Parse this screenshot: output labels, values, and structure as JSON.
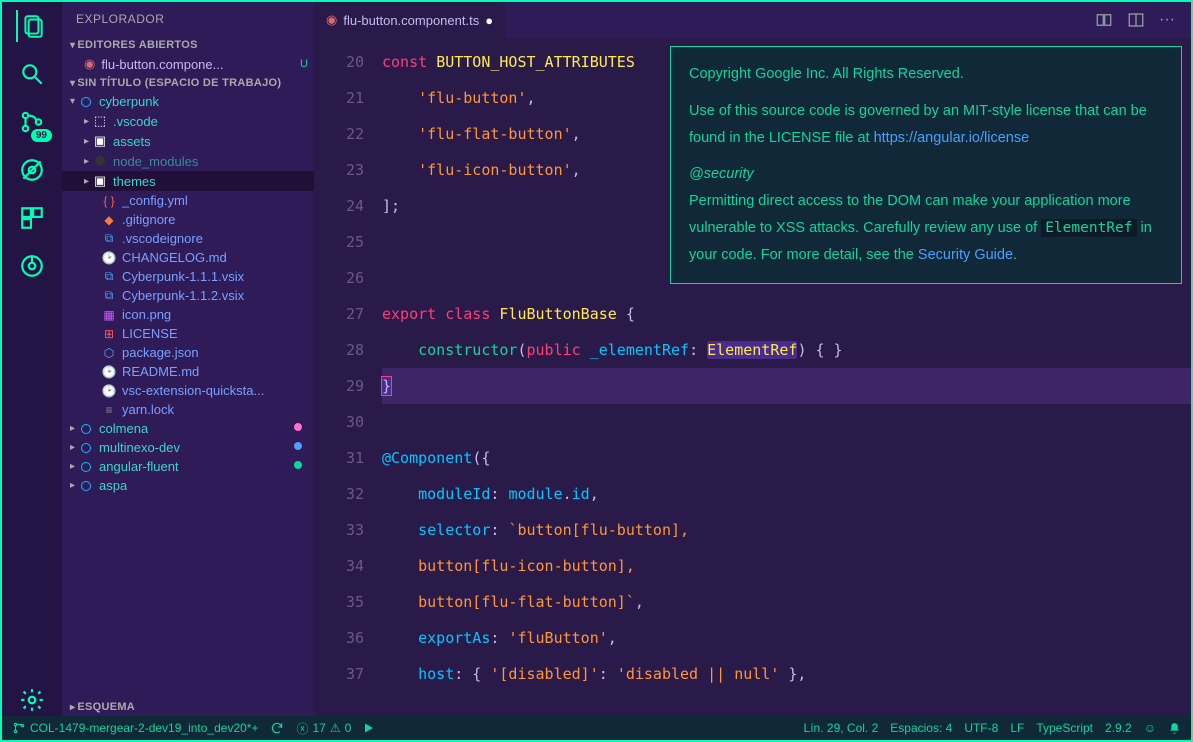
{
  "sidebar": {
    "title": "EXPLORADOR",
    "sections": {
      "open_editors": "EDITORES ABIERTOS",
      "workspace": "SIN TÍTULO (ESPACIO DE TRABAJO)",
      "outline": "ESQUEMA"
    },
    "open_editor": {
      "name": "flu-button.compone...",
      "status": "U"
    },
    "tree": [
      {
        "label": "cyberpunk",
        "kind": "root",
        "indent": 0
      },
      {
        "label": ".vscode",
        "kind": "folder",
        "indent": 1,
        "icon": "vscode"
      },
      {
        "label": "assets",
        "kind": "folder",
        "indent": 1,
        "icon": "assets"
      },
      {
        "label": "node_modules",
        "kind": "folder",
        "indent": 1,
        "icon": "node",
        "muted": true
      },
      {
        "label": "themes",
        "kind": "folder",
        "indent": 1,
        "icon": "folder",
        "selected": true
      },
      {
        "label": "_config.yml",
        "kind": "file",
        "indent": 2,
        "icon": "yml"
      },
      {
        "label": ".gitignore",
        "kind": "file",
        "indent": 2,
        "icon": "git"
      },
      {
        "label": ".vscodeignore",
        "kind": "file",
        "indent": 2,
        "icon": "vs"
      },
      {
        "label": "CHANGELOG.md",
        "kind": "file",
        "indent": 2,
        "icon": "md"
      },
      {
        "label": "Cyberpunk-1.1.1.vsix",
        "kind": "file",
        "indent": 2,
        "icon": "vs"
      },
      {
        "label": "Cyberpunk-1.1.2.vsix",
        "kind": "file",
        "indent": 2,
        "icon": "vs"
      },
      {
        "label": "icon.png",
        "kind": "file",
        "indent": 2,
        "icon": "img"
      },
      {
        "label": "LICENSE",
        "kind": "file",
        "indent": 2,
        "icon": "lic"
      },
      {
        "label": "package.json",
        "kind": "file",
        "indent": 2,
        "icon": "json"
      },
      {
        "label": "README.md",
        "kind": "file",
        "indent": 2,
        "icon": "md"
      },
      {
        "label": "vsc-extension-quicksta...",
        "kind": "file",
        "indent": 2,
        "icon": "md"
      },
      {
        "label": "yarn.lock",
        "kind": "file",
        "indent": 2,
        "icon": "lock"
      },
      {
        "label": "colmena",
        "kind": "root2",
        "indent": 0,
        "dot": "#ff70cc"
      },
      {
        "label": "multinexo-dev",
        "kind": "root2",
        "indent": 0,
        "dot": "#4da0ff"
      },
      {
        "label": "angular-fluent",
        "kind": "root2",
        "indent": 0,
        "dot": "#0dd69e"
      },
      {
        "label": "aspa",
        "kind": "root2",
        "indent": 0
      }
    ]
  },
  "activity": {
    "scm_badge": "99"
  },
  "tabs": {
    "current": "flu-button.component.ts"
  },
  "editor": {
    "lines": [
      {
        "n": 20,
        "html": "<span class='kw'>const</span> <span class='type'>BUTTON_HOST_ATTRIBUTES</span>"
      },
      {
        "n": 21,
        "html": "    <span class='str'>'flu-button'</span><span class='punc'>,</span>"
      },
      {
        "n": 22,
        "html": "    <span class='str'>'flu-flat-button'</span><span class='punc'>,</span>"
      },
      {
        "n": 23,
        "html": "    <span class='str'>'flu-icon-button'</span><span class='punc'>,</span>"
      },
      {
        "n": 24,
        "html": "<span class='punc'>];</span>"
      },
      {
        "n": 25,
        "html": ""
      },
      {
        "n": 26,
        "html": ""
      },
      {
        "n": 27,
        "html": "<span class='kw'>export</span> <span class='kw'>class</span> <span class='type'>FluButtonBase</span> <span class='punc'>{</span>"
      },
      {
        "n": 28,
        "html": "    <span class='grn'>constructor</span><span class='punc'>(</span><span class='kw'>public</span> <span class='var'>_elementRef</span><span class='punc'>:</span> <span class='type sel-bg'>ElementRef</span><span class='punc'>) { }</span>"
      },
      {
        "n": 29,
        "html": "<span class='punc' style='background:#4a2c90;outline:1px solid #ff3d7a;'>}</span>",
        "hl": true
      },
      {
        "n": 30,
        "html": ""
      },
      {
        "n": 31,
        "html": "<span class='at'>@Component</span><span class='punc'>({</span>"
      },
      {
        "n": 32,
        "html": "    <span class='attr'>moduleId</span><span class='punc'>:</span> <span class='var'>module</span><span class='punc'>.</span><span class='var'>id</span><span class='punc'>,</span>"
      },
      {
        "n": 33,
        "html": "    <span class='attr'>selector</span><span class='punc'>:</span> <span class='str'>`button[flu-button],</span>"
      },
      {
        "n": 34,
        "html": "    <span class='str'>button[flu-icon-button],</span>"
      },
      {
        "n": 35,
        "html": "    <span class='str'>button[flu-flat-button]`</span><span class='punc'>,</span>"
      },
      {
        "n": 36,
        "html": "    <span class='attr'>exportAs</span><span class='punc'>:</span> <span class='str'>'fluButton'</span><span class='punc'>,</span>"
      },
      {
        "n": 37,
        "html": "    <span class='attr'>host</span><span class='punc'>: {</span> <span class='str'>'[disabled]'</span><span class='punc'>:</span> <span class='str'>'disabled || null'</span> <span class='punc'>},</span>"
      }
    ]
  },
  "hover": {
    "p1": "Copyright Google Inc. All Rights Reserved.",
    "p2a": "Use of this source code is governed by an MIT-style license that can be found in the LICENSE file at ",
    "p2link": "https://angular.io/license",
    "sec": "@security",
    "p3a": "Permitting direct access to the DOM can make your application more vulnerable to XSS attacks. Carefully review any use of ",
    "p3code": "ElementRef",
    "p3b": " in your code. For more detail, see the ",
    "p3link": "Security Guide",
    "p3c": "."
  },
  "statusbar": {
    "branch": "COL-1479-mergear-2-dev19_into_dev20*+",
    "errors": "17",
    "warnings": "0",
    "pos": "Lín. 29, Col. 2",
    "spaces": "Espacios: 4",
    "encoding": "UTF-8",
    "eol": "LF",
    "lang": "TypeScript",
    "ver": "2.9.2"
  },
  "colors": {
    "accent": "#00ffb3",
    "fg": "#c8b8f0"
  }
}
